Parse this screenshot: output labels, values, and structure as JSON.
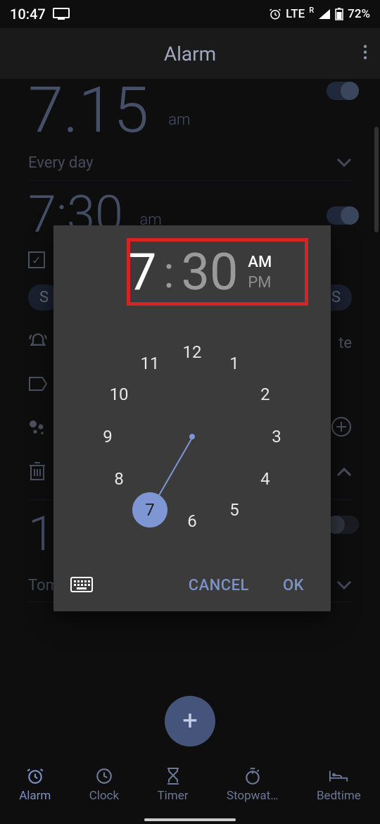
{
  "status": {
    "time": "10:47",
    "network": "LTE",
    "roaming": "R",
    "battery": "72%"
  },
  "appbar": {
    "title": "Alarm"
  },
  "bg": {
    "alarm1": {
      "time": "7.15",
      "period": "am"
    },
    "everyday": "Every day",
    "alarm2": {
      "time": "7:30",
      "period": "am"
    },
    "day_letter": "S",
    "day_letter2": "S",
    "tomorrow": "Tomorrow",
    "big1": "1"
  },
  "picker": {
    "hour": "7",
    "minute": "30",
    "am": "AM",
    "pm": "PM",
    "cancel": "CANCEL",
    "ok": "OK",
    "hours": [
      "12",
      "1",
      "2",
      "3",
      "4",
      "5",
      "6",
      "7",
      "8",
      "9",
      "10",
      "11"
    ],
    "selected_hour_index": 7
  },
  "nav": {
    "items": [
      {
        "label": "Alarm"
      },
      {
        "label": "Clock"
      },
      {
        "label": "Timer"
      },
      {
        "label": "Stopwat…"
      },
      {
        "label": "Bedtime"
      }
    ]
  }
}
